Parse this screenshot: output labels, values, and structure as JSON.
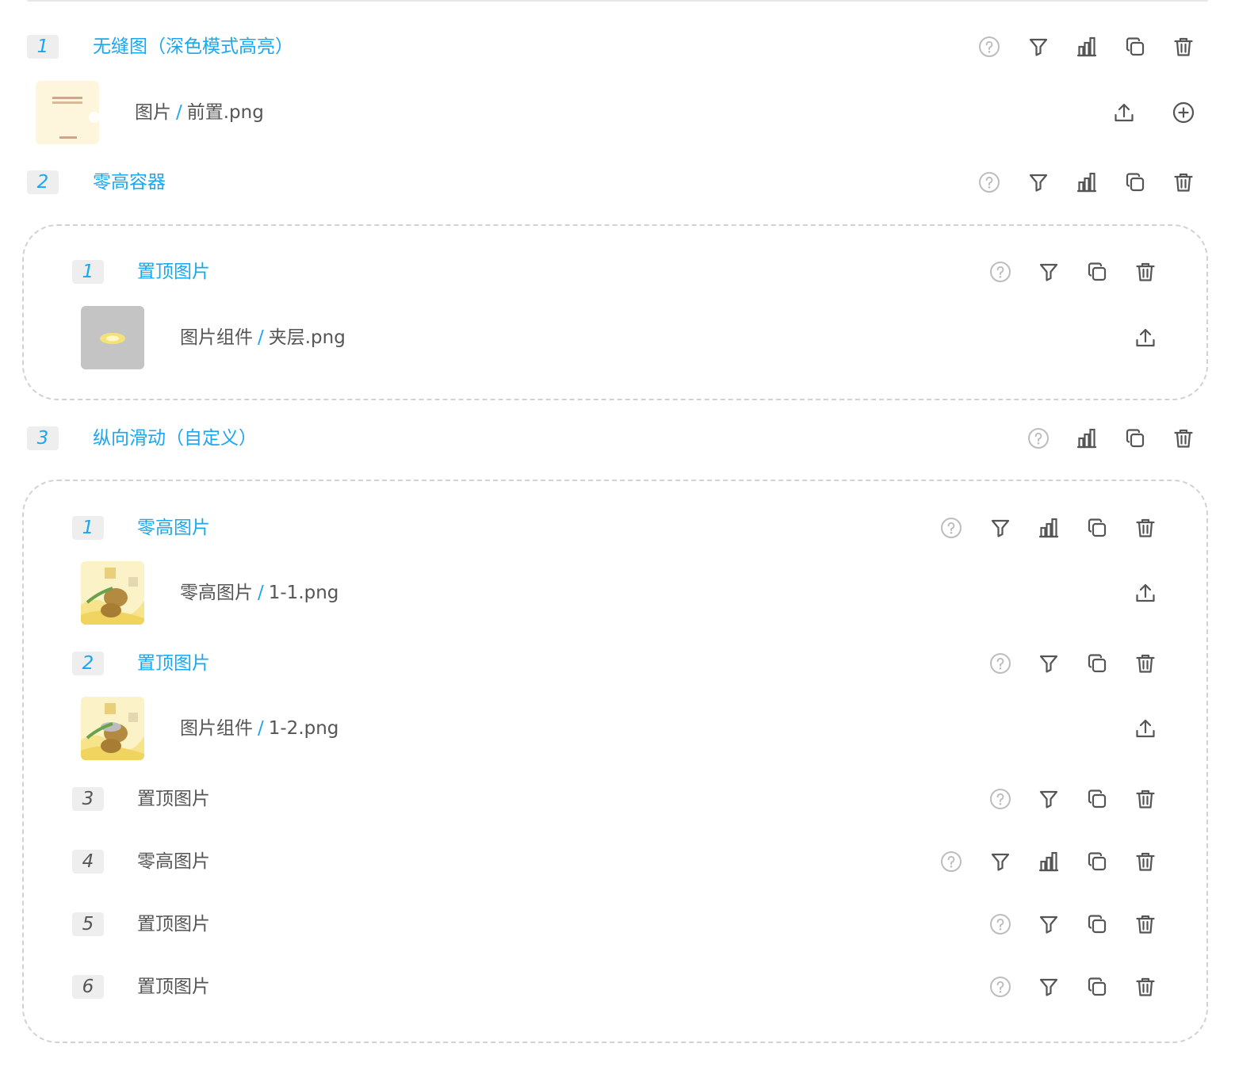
{
  "items": [
    {
      "index": "1",
      "title": "无缝图（深色模式高亮）",
      "file": {
        "folder": "图片",
        "name": "前置.png"
      }
    },
    {
      "index": "2",
      "title": "零高容器",
      "children": [
        {
          "index": "1",
          "title": "置顶图片",
          "file": {
            "folder": "图片组件",
            "name": "夹层.png"
          }
        }
      ]
    },
    {
      "index": "3",
      "title": "纵向滑动（自定义）",
      "children": [
        {
          "index": "1",
          "title": "零高图片",
          "file": {
            "folder": "零高图片",
            "name": "1-1.png"
          }
        },
        {
          "index": "2",
          "title": "置顶图片",
          "file": {
            "folder": "图片组件",
            "name": "1-2.png"
          }
        },
        {
          "index": "3",
          "title": "置顶图片"
        },
        {
          "index": "4",
          "title": "零高图片"
        },
        {
          "index": "5",
          "title": "置顶图片"
        },
        {
          "index": "6",
          "title": "置顶图片"
        }
      ]
    }
  ],
  "path_separator": "/",
  "colors": {
    "accent": "#1aa7f0",
    "text": "#555555",
    "badge_bg": "#eeeeee",
    "dashed_border": "#d2d2d2"
  }
}
